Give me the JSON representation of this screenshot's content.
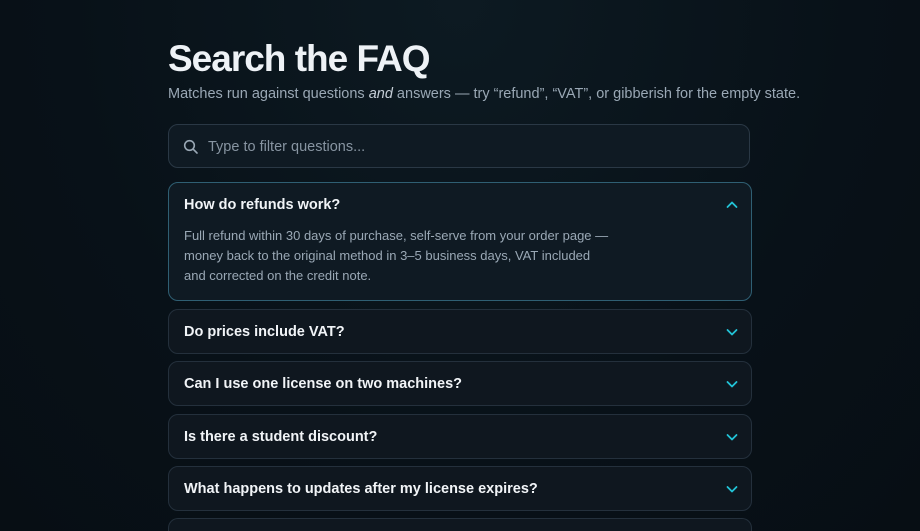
{
  "page": {
    "title": "Search the FAQ",
    "subtitle_before": "Matches run against questions ",
    "subtitle_em": "and",
    "subtitle_after": " answers — try “refund”, “VAT”, or gibberish for the empty state."
  },
  "search": {
    "placeholder": "Type to filter questions...",
    "value": "",
    "icon": "search-icon"
  },
  "colors": {
    "accent": "#22c3d6",
    "background": "#081118",
    "card": "#0f171f",
    "open_border": "#2f5f73"
  },
  "faq": [
    {
      "question": "How do refunds work?",
      "answer": "Full refund within 30 days of purchase, self-serve from your order page — money back to the original method in 3–5 business days, VAT included and corrected on the credit note.",
      "expanded": true
    },
    {
      "question": "Do prices include VAT?",
      "expanded": false
    },
    {
      "question": "Can I use one license on two machines?",
      "expanded": false
    },
    {
      "question": "Is there a student discount?",
      "expanded": false
    },
    {
      "question": "What happens to updates after my license expires?",
      "expanded": false
    }
  ]
}
